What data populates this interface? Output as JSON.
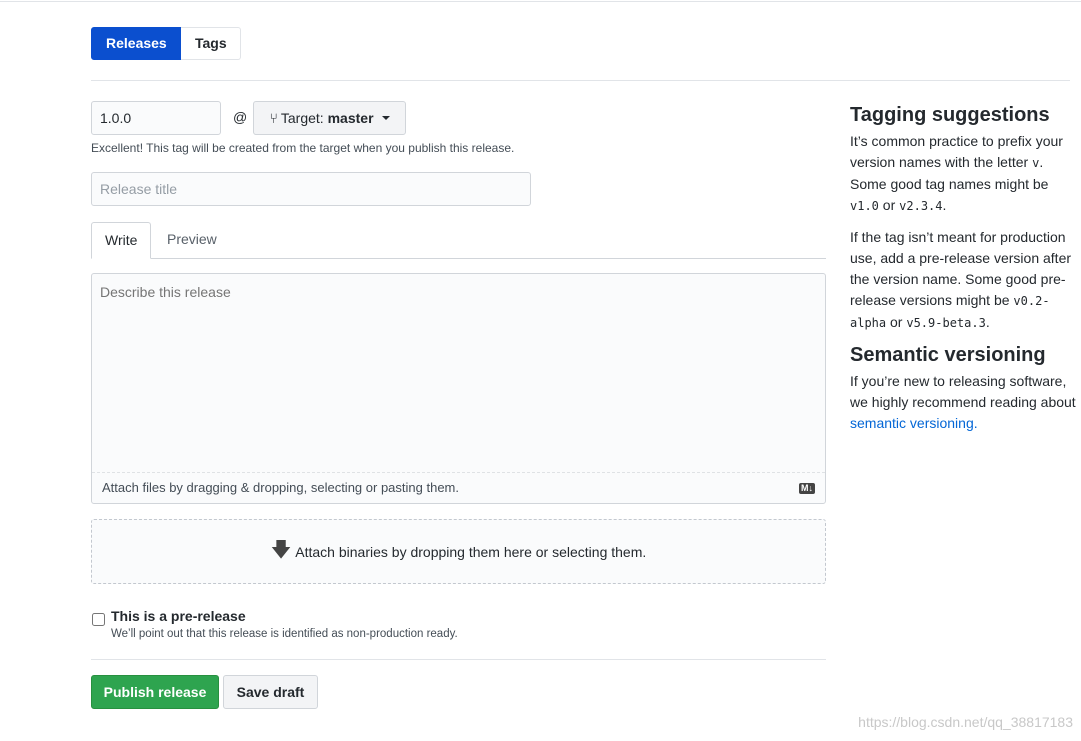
{
  "nav": {
    "tabs": [
      {
        "label": "Releases",
        "active": true
      },
      {
        "label": "Tags",
        "active": false
      }
    ]
  },
  "form": {
    "tag_value": "1.0.0",
    "at": "@",
    "target_prefix": "Target:",
    "target_branch": "master",
    "tag_note": "Excellent! This tag will be created from the target when you publish this release.",
    "title_placeholder": "Release title",
    "editor_tabs": [
      "Write",
      "Preview"
    ],
    "body_placeholder": "Describe this release",
    "attach_files": "Attach files by dragging & dropping, selecting or pasting them.",
    "markdown_badge": "M↓",
    "attach_binaries": "Attach binaries by dropping them here or selecting them.",
    "prerelease_label": "This is a pre-release",
    "prerelease_checked": false,
    "prerelease_note": "We’ll point out that this release is identified as non-production ready.",
    "publish": "Publish release",
    "save_draft": "Save draft"
  },
  "sidebar": {
    "h1": "Tagging suggestions",
    "p1a": "It’s common practice to prefix your version names with the letter ",
    "p1v": "v",
    "p1b": ". Some good tag names might be ",
    "p1c1": "v1.0",
    "p1or": " or ",
    "p1c2": "v2.3.4",
    "p1end": ".",
    "p2a": "If the tag isn’t meant for production use, add a pre-release version after the version name. Some good pre-release versions might be ",
    "p2c1": "v0.2-alpha",
    "p2or": " or ",
    "p2c2": "v5.9-beta.3",
    "p2end": ".",
    "h2": "Semantic versioning",
    "p3": "If you’re new to releasing software, we highly recommend reading about ",
    "link": "semantic versioning."
  },
  "watermark": "https://blog.csdn.net/qq_38817183",
  "colors": {
    "primary": "#0b4fcf",
    "publish": "#2ea44f",
    "link": "#0366d6"
  }
}
